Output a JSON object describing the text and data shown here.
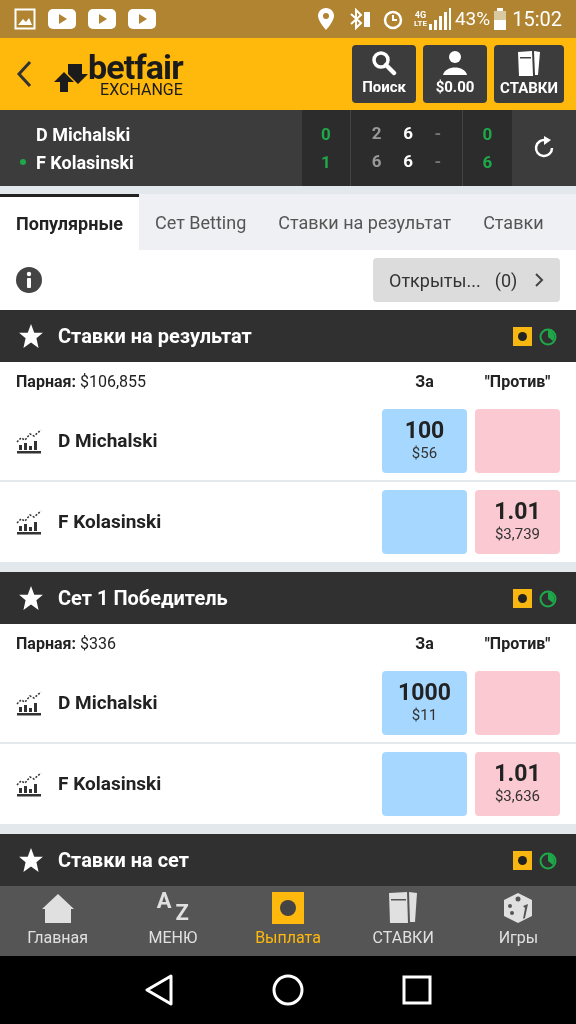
{
  "status_bar": {
    "network": "4G",
    "network_sub": "LTE",
    "battery": "43%",
    "time": "15:02"
  },
  "header": {
    "logo": "betfair",
    "logo_sub": "EXCHANGE",
    "buttons": [
      {
        "kind": "search",
        "label": "Поиск"
      },
      {
        "kind": "account",
        "label": "$0.00"
      },
      {
        "kind": "bets",
        "label": "СТАВКИ"
      }
    ]
  },
  "score": {
    "players": [
      {
        "name": "D Michalski",
        "serving": false
      },
      {
        "name": "F Kolasinski",
        "serving": true
      }
    ],
    "sets": [
      "0",
      "1"
    ],
    "games": [
      [
        "2",
        "6",
        "-"
      ],
      [
        "6",
        "6",
        "-"
      ]
    ],
    "points": [
      "0",
      "6"
    ]
  },
  "tabs": [
    {
      "label": "Популярные",
      "selected": true
    },
    {
      "label": "Сет Betting",
      "selected": false
    },
    {
      "label": "Ставки на результат",
      "selected": false
    },
    {
      "label": "Ставки",
      "selected": false
    }
  ],
  "open_bets": {
    "label": "Открыты...",
    "count": "(0)"
  },
  "markets": [
    {
      "title": "Ставки на результат",
      "matched_label": "Парная:",
      "matched": "$106,855",
      "back_header": "За",
      "lay_header": "\"Против\"",
      "runners": [
        {
          "name": "D Michalski",
          "back": {
            "odds": "100",
            "amount": "$56"
          }
        },
        {
          "name": "F Kolasinski",
          "lay": {
            "odds": "1.01",
            "amount": "$3,739"
          }
        }
      ]
    },
    {
      "title": "Сет 1 Победитель",
      "matched_label": "Парная:",
      "matched": "$336",
      "back_header": "За",
      "lay_header": "\"Против\"",
      "runners": [
        {
          "name": "D Michalski",
          "back": {
            "odds": "1000",
            "amount": "$11"
          }
        },
        {
          "name": "F Kolasinski",
          "lay": {
            "odds": "1.01",
            "amount": "$3,636"
          }
        }
      ]
    },
    {
      "title": "Ставки на сет"
    }
  ],
  "bottom_nav": [
    {
      "kind": "home",
      "label": "Главная",
      "selected": false
    },
    {
      "kind": "menu",
      "label": "МЕНЮ",
      "icon_letters": [
        "A",
        "Z"
      ],
      "selected": false
    },
    {
      "kind": "cashout",
      "label": "Выплата",
      "selected": true
    },
    {
      "kind": "bets",
      "label": "СТАВКИ",
      "selected": false
    },
    {
      "kind": "games",
      "label": "Игры",
      "selected": false
    }
  ]
}
